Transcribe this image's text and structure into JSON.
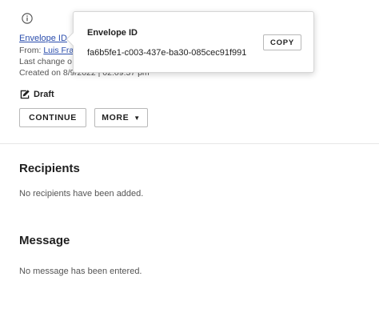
{
  "header": {
    "info_icon": "info-circle-icon",
    "envelope_id_link": "Envelope ID",
    "from_prefix": "From: ",
    "from_name": "Luis Fra",
    "last_change": "Last change o",
    "created": "Created on 8/9/2022 | 02:09:37 pm"
  },
  "status": {
    "icon": "draft-edit-icon",
    "label": "Draft"
  },
  "actions": {
    "continue_label": "CONTINUE",
    "more_label": "MORE",
    "more_icon": "caret-down-icon"
  },
  "recipients": {
    "heading": "Recipients",
    "empty_text": "No recipients have been added."
  },
  "message": {
    "heading": "Message",
    "empty_text": "No message has been entered."
  },
  "popover": {
    "title": "Envelope ID",
    "value": "fa6b5fe1-c003-437e-ba30-085cec91f991",
    "copy_label": "COPY"
  },
  "colors": {
    "link": "#2a4dad",
    "text": "#1f1f1f",
    "muted": "#555555",
    "border": "#b8b8b8"
  }
}
